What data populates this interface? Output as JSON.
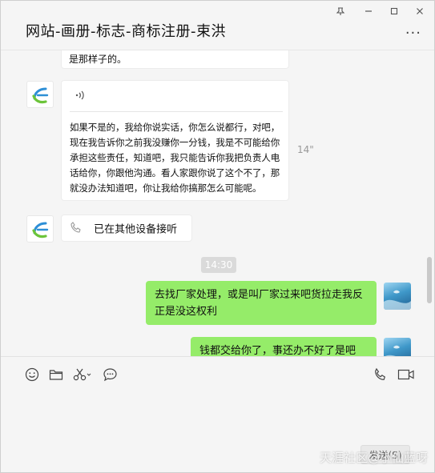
{
  "window": {
    "title": "网站-画册-标志-商标注册-束洪",
    "pin_icon": "pin-icon",
    "more_label": "···"
  },
  "chat": {
    "partial_message": "是那样子的。",
    "voice_message": {
      "duration": "14\"",
      "transcript": "如果不是的，我给你说实话，你怎么说都行，对吧，现在我告诉你之前我没赚你一分钱，我是不可能给你承担这些责任，知道吧，我只能告诉你我把负责人电话给你，你跟他沟通。看人家跟你说了这个不了，那就没办法知道吧，你让我给你搞那怎么可能呢。"
    },
    "call_notice": "已在其他设备接听",
    "timestamp": "14:30",
    "outgoing_1": "去找厂家处理，或是叫厂家过来吧货拉走我反正是没这权利",
    "outgoing_2": "钱都交给你了，事还办不好了是吧"
  },
  "toolbar": {
    "icons": [
      "emoji-icon",
      "folder-icon",
      "scissors-icon",
      "chat-bubble-icon",
      "phone-icon",
      "video-icon"
    ]
  },
  "send": {
    "label": "发送(S)"
  },
  "watermark": "天涯社区@小仙蓝呀",
  "colors": {
    "outgoing_bubble": "#95ec69",
    "incoming_bubble": "#ffffff",
    "background": "#f5f5f5"
  }
}
